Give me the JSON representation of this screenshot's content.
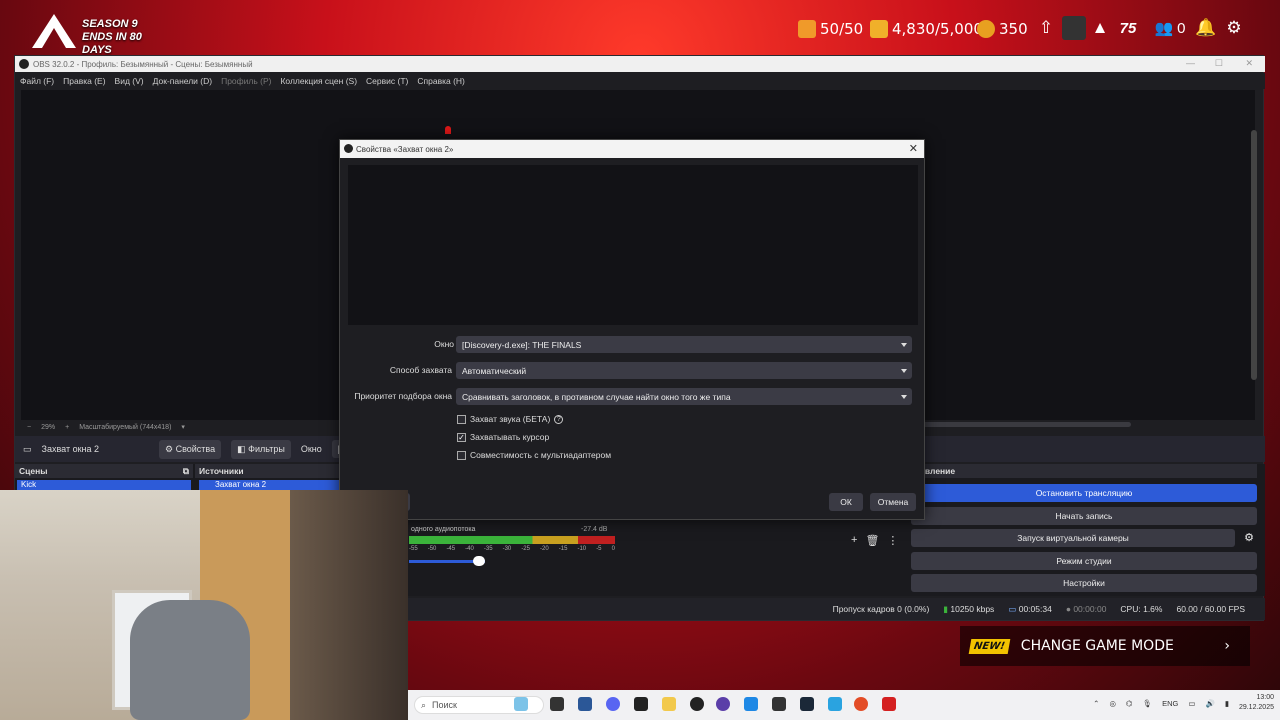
{
  "game": {
    "season_line1": "SEASON 9",
    "season_line2": "ENDS IN 80 DAYS",
    "res1": "50/50",
    "res2": "4,830/5,000",
    "res3": "350",
    "level": "75",
    "friends": "0",
    "change_mode": "CHANGE GAME MODE",
    "new_badge": "NEW!"
  },
  "obs": {
    "title": "OBS 32.0.2 - Профиль: Безымянный - Сцены: Безымянный",
    "menu": [
      "Файл (F)",
      "Правка (E)",
      "Вид (V)",
      "Док-панели (D)",
      "Профиль (P)",
      "Коллекция сцен (S)",
      "Сервис (T)",
      "Справка (H)"
    ],
    "zoom": "29%",
    "scale": "Масштабируемый (744x418)",
    "source_name": "Захват окна 2",
    "props_btn": "Свойства",
    "filters_btn": "Фильтры",
    "window_label": "Окно",
    "window_value_partial": "[Вы",
    "scenes_header": "Сцены",
    "sources_header": "Источники",
    "scene_item": "Kick",
    "source_item": "Захват окна 2",
    "controls_header_partial": "равление",
    "audio_label_partial": "одного аудиопотока",
    "audio_db": "-27.4 dB",
    "audio_ticks": [
      "-55",
      "-50",
      "-45",
      "-40",
      "-35",
      "-30",
      "-25",
      "-20",
      "-15",
      "-10",
      "-5",
      "0"
    ],
    "controls": {
      "stop_stream": "Остановить трансляцию",
      "start_record": "Начать запись",
      "virtual_cam": "Запуск виртуальной камеры",
      "studio_mode": "Режим студии",
      "settings": "Настройки"
    },
    "status": {
      "dropped": "Пропуск кадров 0 (0.0%)",
      "bitrate": "10250 kbps",
      "stream_time": "00:05:34",
      "rec_time": "00:00:00",
      "cpu": "CPU: 1.6%",
      "fps": "60.00 / 60.00 FPS"
    }
  },
  "dialog": {
    "title": "Свойства «Захват окна 2»",
    "window_label": "Окно",
    "window_value": "[Discovery-d.exe]: THE FINALS",
    "method_label": "Способ захвата",
    "method_value": "Автоматический",
    "priority_label": "Приоритет подбора окна",
    "priority_value": "Сравнивать заголовок, в противном случае найти окно того же типа",
    "chk_audio": "Захват звука (БЕТА)",
    "chk_cursor": "Захватывать курсор",
    "chk_multi": "Совместимость с мультиадаптером",
    "defaults_partial": "ю",
    "ok": "ОК",
    "cancel": "Отмена"
  },
  "taskbar": {
    "search": "Поиск",
    "lang": "ENG",
    "time": "13:00",
    "date": "29.12.2025"
  }
}
